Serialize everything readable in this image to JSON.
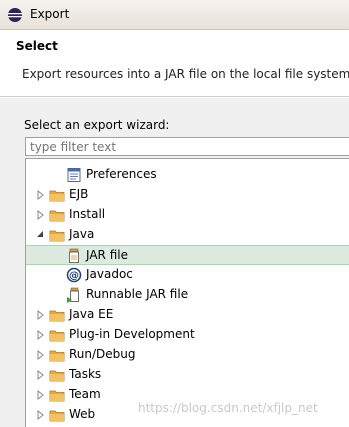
{
  "window": {
    "title": "Export"
  },
  "header": {
    "title": "Select",
    "description": "Export resources into a JAR file on the local file system."
  },
  "wizard": {
    "label": "Select an export wizard:",
    "filter_placeholder": "type filter text"
  },
  "tree": [
    {
      "label": "Preferences",
      "icon": "preferences-icon",
      "level": 1,
      "expander": "none"
    },
    {
      "label": "EJB",
      "icon": "folder-icon",
      "level": 0,
      "expander": "collapsed"
    },
    {
      "label": "Install",
      "icon": "folder-icon",
      "level": 0,
      "expander": "collapsed"
    },
    {
      "label": "Java",
      "icon": "folder-icon",
      "level": 0,
      "expander": "expanded"
    },
    {
      "label": "JAR file",
      "icon": "jar-file-icon",
      "level": 1,
      "expander": "none",
      "selected": true
    },
    {
      "label": "Javadoc",
      "icon": "javadoc-icon",
      "level": 1,
      "expander": "none"
    },
    {
      "label": "Runnable JAR file",
      "icon": "runnable-jar-icon",
      "level": 1,
      "expander": "none"
    },
    {
      "label": "Java EE",
      "icon": "folder-icon",
      "level": 0,
      "expander": "collapsed"
    },
    {
      "label": "Plug-in Development",
      "icon": "folder-icon",
      "level": 0,
      "expander": "collapsed"
    },
    {
      "label": "Run/Debug",
      "icon": "folder-icon",
      "level": 0,
      "expander": "collapsed"
    },
    {
      "label": "Tasks",
      "icon": "folder-icon",
      "level": 0,
      "expander": "collapsed"
    },
    {
      "label": "Team",
      "icon": "folder-icon",
      "level": 0,
      "expander": "collapsed"
    },
    {
      "label": "Web",
      "icon": "folder-icon",
      "level": 0,
      "expander": "collapsed"
    }
  ],
  "watermark": "https://blog.csdn.net/xfjlp_net",
  "colors": {
    "selection": "#dceadf",
    "folder": "#e0a040"
  }
}
